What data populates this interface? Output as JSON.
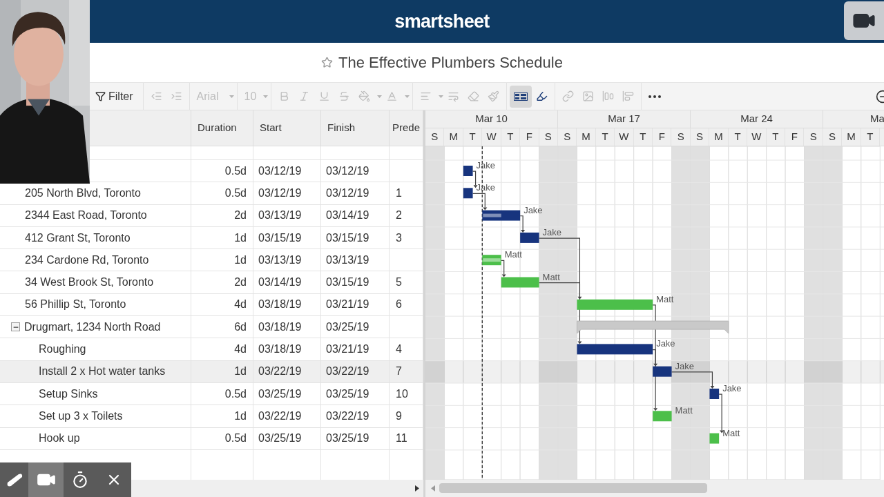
{
  "app": {
    "logo": "smartsheet"
  },
  "sheet": {
    "title": "The Effective Plumbers Schedule",
    "favorite": false
  },
  "toolbar": {
    "filter": "Filter",
    "font": "Arial",
    "font_size": "10",
    "gantt_view_selected": true
  },
  "columns": [
    "Duration",
    "Start",
    "Finish",
    "Prede"
  ],
  "timeline": {
    "weeks": [
      "Mar 10",
      "Mar 17",
      "Mar 24",
      "Ma"
    ],
    "days": [
      {
        "label": "S",
        "weekend": true
      },
      {
        "label": "M",
        "weekend": false
      },
      {
        "label": "T",
        "weekend": false
      },
      {
        "label": "W",
        "weekend": false
      },
      {
        "label": "T",
        "weekend": false
      },
      {
        "label": "F",
        "weekend": false
      },
      {
        "label": "S",
        "weekend": true
      },
      {
        "label": "S",
        "weekend": true
      },
      {
        "label": "M",
        "weekend": false
      },
      {
        "label": "T",
        "weekend": false
      },
      {
        "label": "W",
        "weekend": false
      },
      {
        "label": "T",
        "weekend": false
      },
      {
        "label": "F",
        "weekend": false
      },
      {
        "label": "S",
        "weekend": true
      },
      {
        "label": "S",
        "weekend": true
      },
      {
        "label": "M",
        "weekend": false
      },
      {
        "label": "T",
        "weekend": false
      },
      {
        "label": "W",
        "weekend": false
      },
      {
        "label": "T",
        "weekend": false
      },
      {
        "label": "F",
        "weekend": false
      },
      {
        "label": "S",
        "weekend": true
      },
      {
        "label": "S",
        "weekend": true
      },
      {
        "label": "M",
        "weekend": false
      },
      {
        "label": "T",
        "weekend": false
      }
    ]
  },
  "rows": [
    {
      "duration": "0.5d",
      "start": "03/12/19",
      "finish": "03/12/19",
      "assigned_to": "Jake",
      "color": "#17347e",
      "selected": false
    },
    {
      "name": "205 North Blvd, Toronto",
      "duration": "0.5d",
      "start": "03/12/19",
      "finish": "03/12/19",
      "predecessors": "1",
      "assigned_to": "Jake",
      "color": "#17347e",
      "selected": false
    },
    {
      "name": "2344 East Road, Toronto",
      "duration": "2d",
      "start": "03/13/19",
      "finish": "03/14/19",
      "predecessors": "2",
      "assigned_to": "Jake",
      "color": "#17347e",
      "level": 0.5,
      "selected": false
    },
    {
      "name": "412 Grant St, Toronto",
      "duration": "1d",
      "start": "03/15/19",
      "finish": "03/15/19",
      "predecessors": "3",
      "assigned_to": "Jake",
      "color": "#17347e",
      "selected": false
    },
    {
      "name": "234 Cardone Rd, Toronto",
      "duration": "1d",
      "start": "03/13/19",
      "finish": "03/13/19",
      "assigned_to": "Matt",
      "color": "#4cbf4a",
      "level": 1,
      "selected": false
    },
    {
      "name": "34 West Brook St, Toronto",
      "duration": "2d",
      "start": "03/14/19",
      "finish": "03/15/19",
      "predecessors": "5",
      "assigned_to": "Matt",
      "color": "#4cbf4a",
      "selected": false
    },
    {
      "name": "56 Phillip St, Toronto",
      "duration": "4d",
      "start": "03/18/19",
      "finish": "03/21/19",
      "predecessors": "6",
      "assigned_to": "Matt",
      "color": "#4cbf4a",
      "selected": false
    },
    {
      "name": "Drugmart, 1234 North Road",
      "duration": "6d",
      "start": "03/18/19",
      "finish": "03/25/19",
      "expanded": true,
      "selected": false,
      "children": [
        {
          "name": "Roughing",
          "duration": "4d",
          "start": "03/18/19",
          "finish": "03/21/19",
          "predecessors": "4",
          "assigned_to": "Jake",
          "color": "#17347e",
          "selected": false
        },
        {
          "name": "Install 2 x Hot water tanks",
          "duration": "1d",
          "start": "03/22/19",
          "finish": "03/22/19",
          "predecessors": "7",
          "assigned_to": "Jake",
          "color": "#17347e",
          "selected": true
        },
        {
          "name": "Setup Sinks",
          "duration": "0.5d",
          "start": "03/25/19",
          "finish": "03/25/19",
          "predecessors": "10",
          "assigned_to": "Jake",
          "color": "#17347e",
          "selected": false
        },
        {
          "name": "Set up 3 x Toilets",
          "duration": "1d",
          "start": "03/22/19",
          "finish": "03/22/19",
          "predecessors": "9",
          "assigned_to": "Matt",
          "color": "#4cbf4a",
          "selected": false
        },
        {
          "name": "Hook up",
          "duration": "0.5d",
          "start": "03/25/19",
          "finish": "03/25/19",
          "predecessors": "11",
          "assigned_to": "Matt",
          "color": "#4cbf4a",
          "selected": false
        }
      ]
    }
  ],
  "webcam": {
    "kind": "picture"
  },
  "recorder_toolbar": [
    {
      "kind": "marker",
      "selected": false
    },
    {
      "kind": "camera",
      "selected": true
    },
    {
      "kind": "timer",
      "selected": false
    },
    {
      "kind": "close",
      "selected": false
    }
  ]
}
